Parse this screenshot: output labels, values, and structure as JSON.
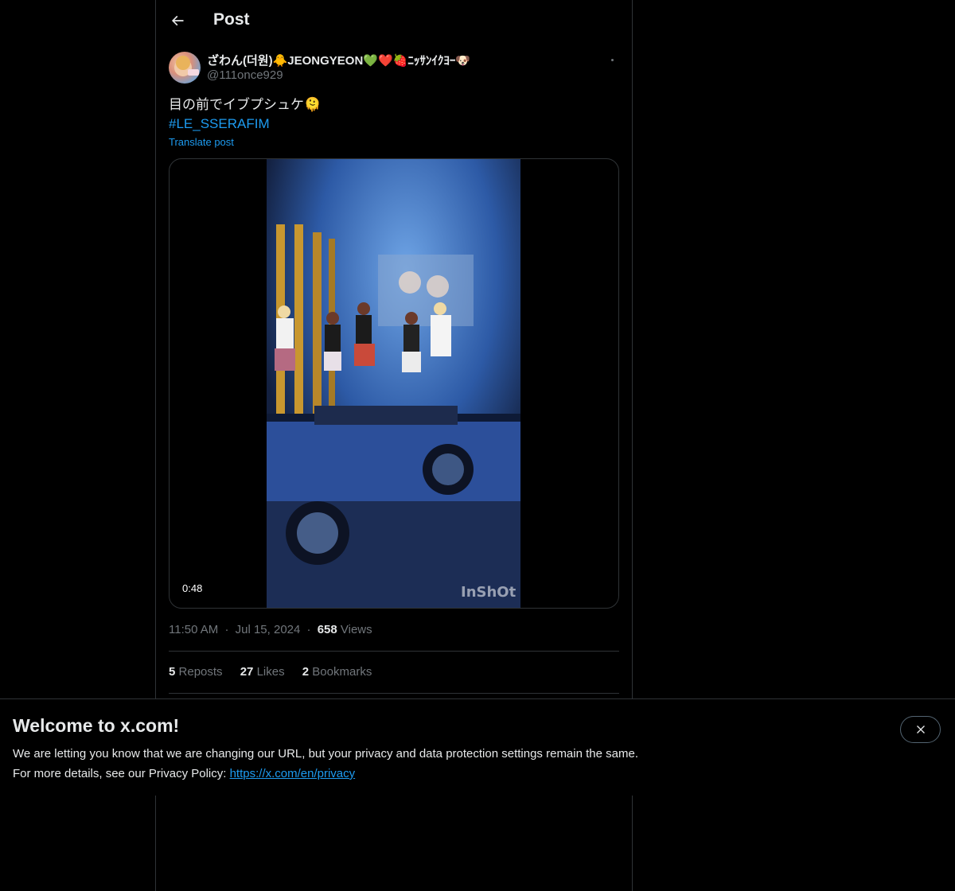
{
  "header": {
    "title": "Post"
  },
  "post": {
    "author": {
      "display_name": "ざわん(더원)🐥JEONGYEON💚❤️🍓ﾆｯｻﾝｲｸﾖｰ🐶",
      "handle": "@111once929"
    },
    "text": "目の前でイブプシュケ🫠",
    "hashtag": "#LE_SSERAFIM",
    "translate_label": "Translate post",
    "media": {
      "duration": "0:48",
      "watermark": "InShOt"
    },
    "meta": {
      "time": "11:50 AM",
      "date": "Jul 15, 2024",
      "views_count": "658",
      "views_label": "Views",
      "separator": "·"
    },
    "stats": {
      "reposts_count": "5",
      "reposts_label": "Reposts",
      "likes_count": "27",
      "likes_label": "Likes",
      "bookmarks_count": "2",
      "bookmarks_label": "Bookmarks"
    }
  },
  "banner": {
    "title": "Welcome to x.com!",
    "line1": "We are letting you know that we are changing our URL, but your privacy and data protection settings remain the same.",
    "line2_prefix": "For more details, see our Privacy Policy: ",
    "link_text": "https://x.com/en/privacy"
  },
  "icons": {
    "back": "arrow-left-icon",
    "more": "more-horizontal-icon",
    "close": "close-icon"
  },
  "colors": {
    "background": "#000000",
    "text": "#e7e9ea",
    "muted": "#71767b",
    "link": "#1d9bf0",
    "border": "#2f3336"
  }
}
